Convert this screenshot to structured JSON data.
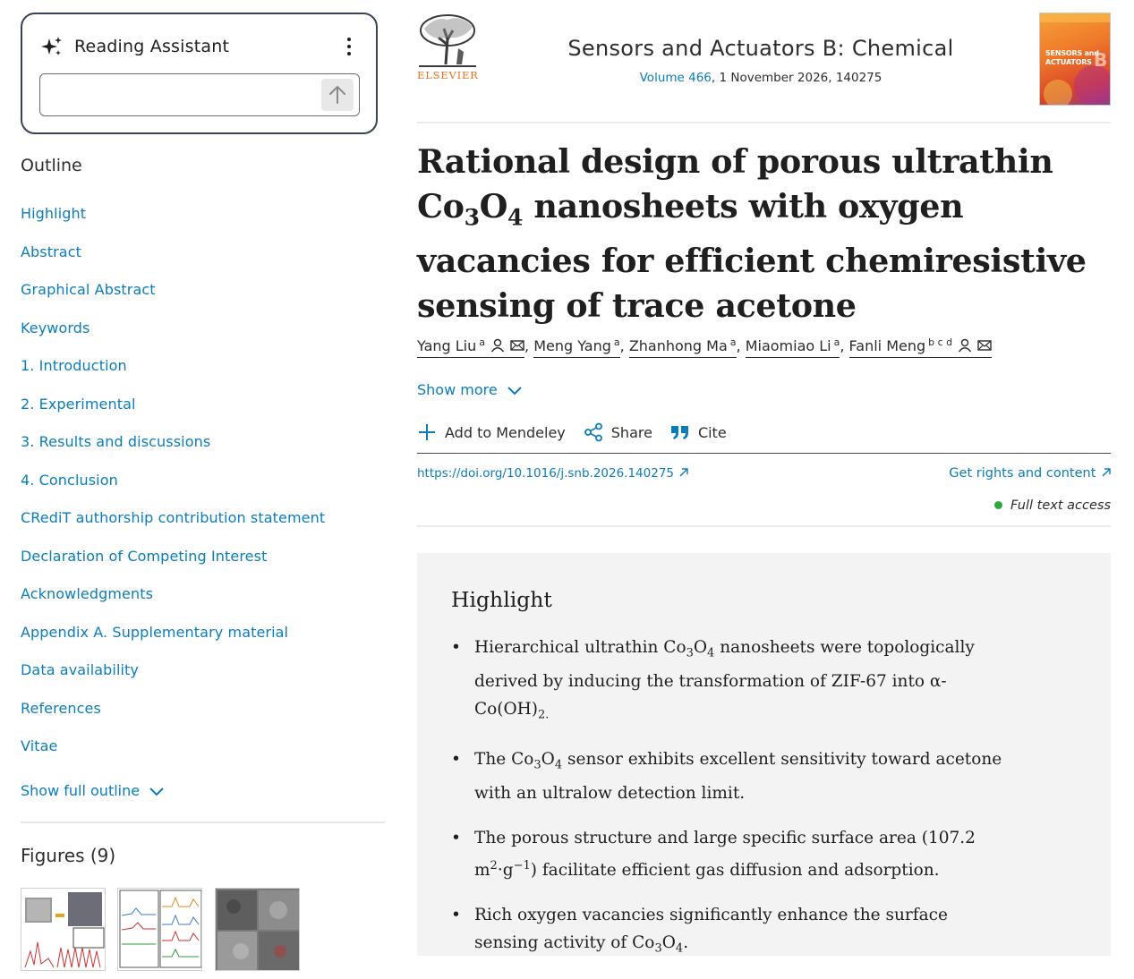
{
  "assistant": {
    "title": "Reading Assistant",
    "input_placeholder": ""
  },
  "outline": {
    "heading": "Outline",
    "items": [
      "Highlight",
      "Abstract",
      "Graphical Abstract",
      "Keywords",
      "1. Introduction",
      "2. Experimental",
      "3. Results and discussions",
      "4. Conclusion",
      "CRediT authorship contribution statement",
      "Declaration of Competing Interest",
      "Acknowledgments",
      "Appendix A. Supplementary material",
      "Data availability",
      "References",
      "Vitae"
    ],
    "show_full": "Show full outline"
  },
  "figures": {
    "heading": "Figures (9)"
  },
  "journal": {
    "publisher": "ELSEVIER",
    "title": "Sensors and Actuators B: Chemical",
    "volume_link": "Volume 466",
    "volume_rest": ", 1 November 2026, 140275",
    "cover_text_1": "SENSORS and",
    "cover_text_2": "ACTUATORS",
    "cover_letter": "B"
  },
  "article": {
    "title_1": "Rational design of porous ultrathin Co",
    "title_sub1": "3",
    "title_2": "O",
    "title_sub2": "4",
    "title_3": " nanosheets with oxygen vacancies for efficient chemiresistive sensing of trace acetone",
    "authors": [
      {
        "name": "Yang Liu",
        "aff": "a"
      },
      {
        "name": "Meng Yang",
        "aff": "a"
      },
      {
        "name": "Zhanhong Ma",
        "aff": "a"
      },
      {
        "name": "Miaomiao Li",
        "aff": "a"
      },
      {
        "name": "Fanli Meng",
        "aff": "b c d"
      }
    ],
    "show_more": "Show more",
    "actions": {
      "mendeley": "Add to Mendeley",
      "share": "Share",
      "cite": "Cite"
    },
    "doi": "https://doi.org/10.1016/j.snb.2026.140275",
    "rights": "Get rights and content",
    "access": "Full text access"
  },
  "highlight": {
    "heading": "Highlight",
    "b1_a": "Hierarchical ultrathin Co",
    "b1_s1": "3",
    "b1_b": "O",
    "b1_s2": "4",
    "b1_c": " nanosheets were topologically derived by inducing the transformation of ZIF-67 into α-Co(OH)",
    "b1_s3": "2.",
    "b2_a": "The Co",
    "b2_s1": "3",
    "b2_b": "O",
    "b2_s2": "4",
    "b2_c": " sensor exhibits excellent sensitivity toward acetone with an ultralow detection limit.",
    "b3_a": "The porous structure and large specific surface area (107.2 m",
    "b3_s1": "2",
    "b3_b": "·g",
    "b3_s2": "−1",
    "b3_c": ") facilitate efficient gas diffusion and adsorption.",
    "b4_a": "Rich oxygen vacancies significantly enhance the surface sensing activity of Co",
    "b4_s1": "3",
    "b4_b": "O",
    "b4_s2": "4",
    "b4_c": "."
  },
  "colors": {
    "link": "#0c7dbb",
    "publisher_orange": "#e9711c",
    "access_green": "#2eaa3b"
  }
}
